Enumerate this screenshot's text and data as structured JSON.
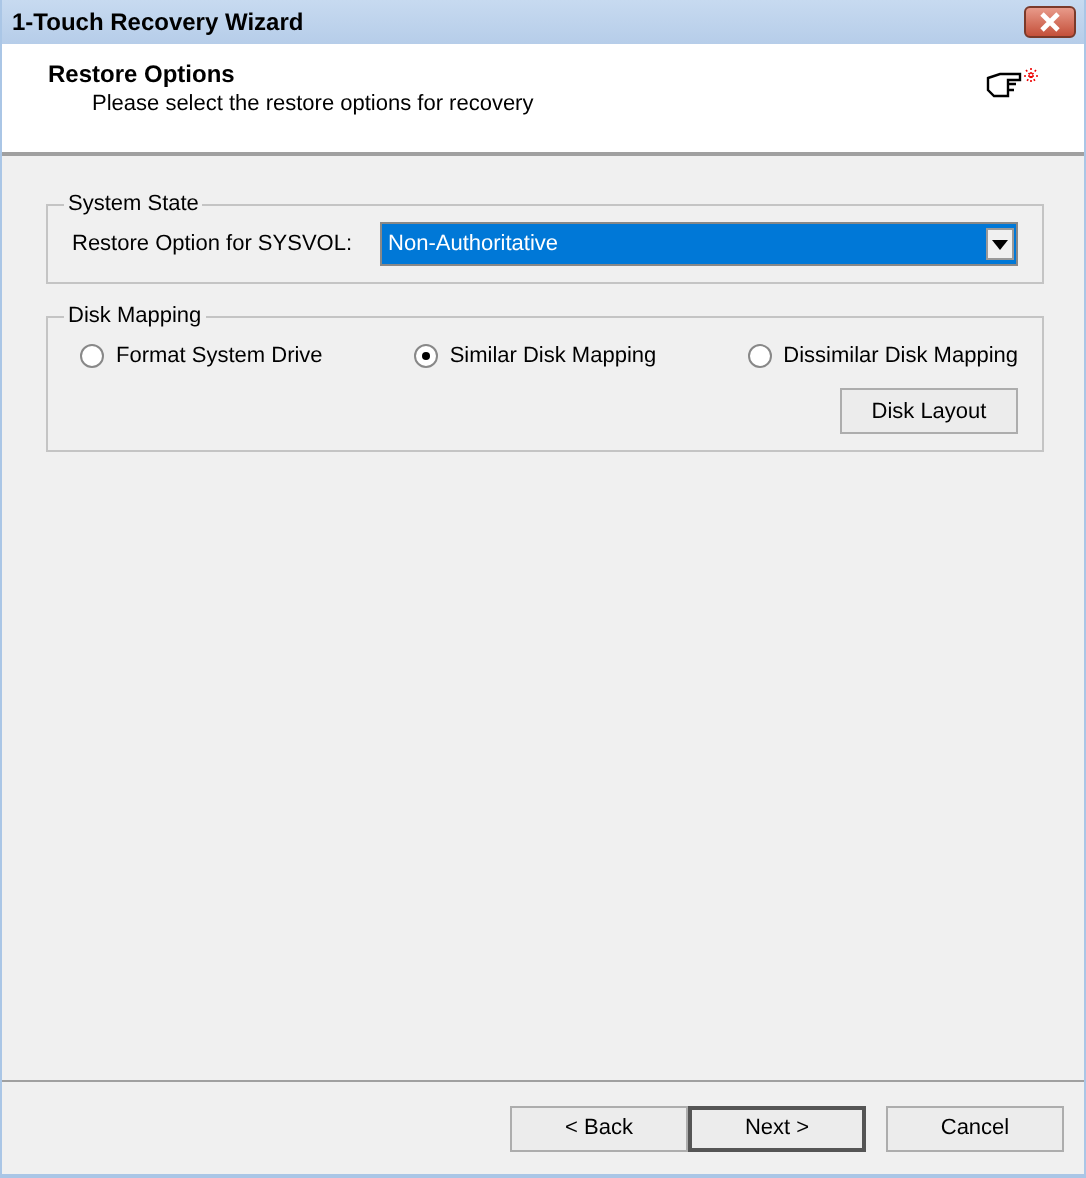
{
  "window": {
    "title": "1-Touch Recovery Wizard"
  },
  "header": {
    "title": "Restore Options",
    "subtitle": "Please select the restore options for recovery"
  },
  "system_state": {
    "legend": "System State",
    "label": "Restore Option for SYSVOL:",
    "value": "Non-Authoritative"
  },
  "disk_mapping": {
    "legend": "Disk Mapping",
    "options": [
      {
        "label": "Format System Drive",
        "selected": false
      },
      {
        "label": "Similar Disk Mapping",
        "selected": true
      },
      {
        "label": "Dissimilar Disk Mapping",
        "selected": false
      }
    ],
    "button": "Disk Layout"
  },
  "buttons": [
    {
      "label": "< Back",
      "default": false
    },
    {
      "label": "Next >",
      "default": true
    },
    {
      "label": "Cancel",
      "default": false
    }
  ]
}
